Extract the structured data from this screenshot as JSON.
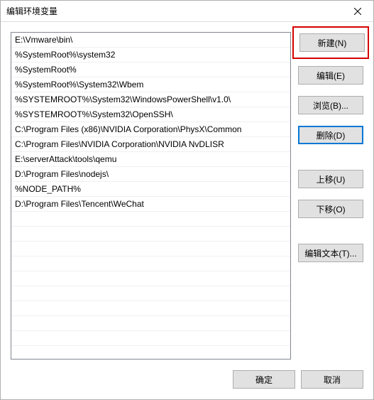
{
  "window": {
    "title": "编辑环境变量"
  },
  "list": {
    "items": [
      "E:\\Vmware\\bin\\",
      "%SystemRoot%\\system32",
      "%SystemRoot%",
      "%SystemRoot%\\System32\\Wbem",
      "%SYSTEMROOT%\\System32\\WindowsPowerShell\\v1.0\\",
      "%SYSTEMROOT%\\System32\\OpenSSH\\",
      "C:\\Program Files (x86)\\NVIDIA Corporation\\PhysX\\Common",
      "C:\\Program Files\\NVIDIA Corporation\\NVIDIA NvDLISR",
      "E:\\serverAttack\\tools\\qemu",
      "D:\\Program Files\\nodejs\\",
      "%NODE_PATH%",
      "D:\\Program Files\\Tencent\\WeChat"
    ]
  },
  "buttons": {
    "new": "新建(N)",
    "edit": "编辑(E)",
    "browse": "浏览(B)...",
    "delete": "删除(D)",
    "moveUp": "上移(U)",
    "moveDown": "下移(O)",
    "editText": "编辑文本(T)...",
    "ok": "确定",
    "cancel": "取消"
  }
}
